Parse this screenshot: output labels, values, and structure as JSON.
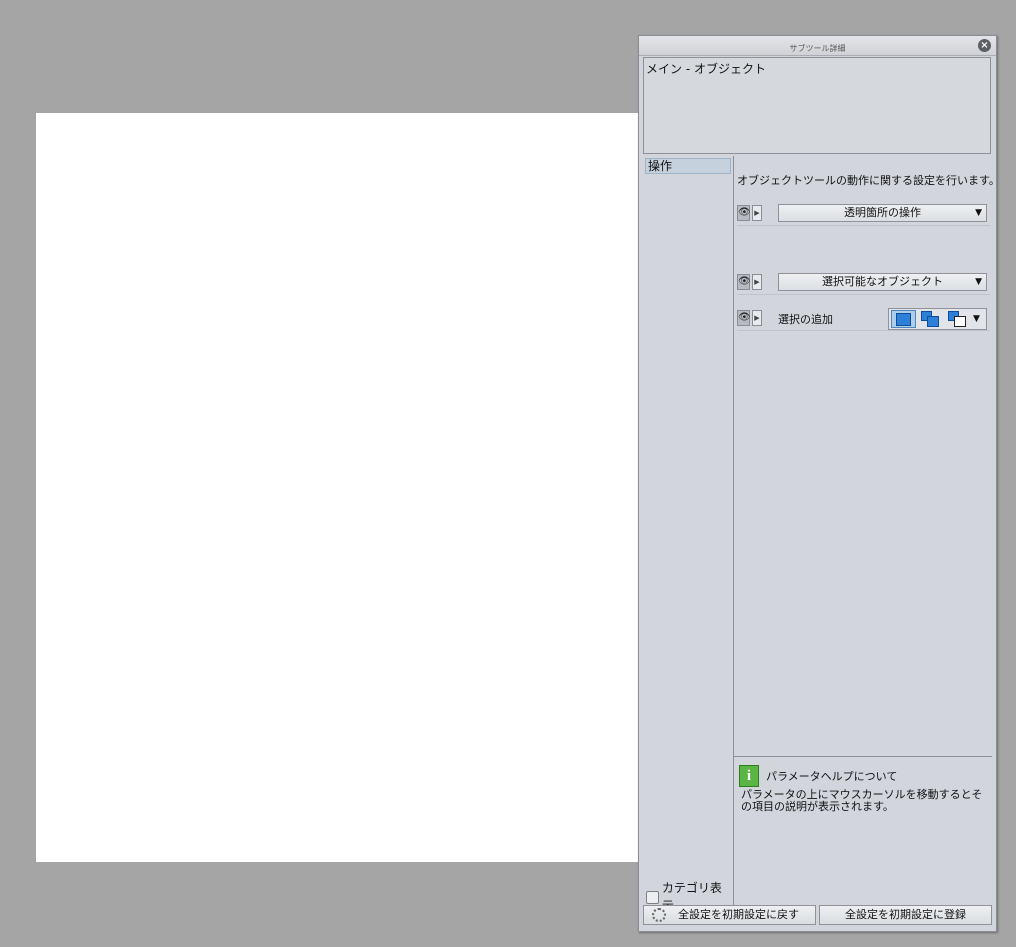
{
  "panel": {
    "title": "サブツール詳細",
    "close_icon": "×",
    "subtool_name": "メイン - オブジェクト"
  },
  "categories": {
    "items": [
      {
        "label": "操作"
      }
    ],
    "show_category_label": "カテゴリ表示"
  },
  "settings": {
    "description": "オブジェクトツールの動作に関する設定を行います。",
    "rows": [
      {
        "type": "dropdown",
        "label": "透明箇所の操作"
      },
      {
        "type": "dropdown",
        "label": "選択可能なオブジェクト"
      },
      {
        "type": "mode_select",
        "label": "選択の追加",
        "modes": [
          "new-selection",
          "add-to-selection",
          "toggle-selection"
        ],
        "active": "new-selection"
      }
    ]
  },
  "help": {
    "title": "パラメータヘルプについて",
    "body": "パラメータの上にマウスカーソルを移動するとその項目の説明が表示されます。"
  },
  "footer": {
    "reset_label": "全設定を初期設定に戻す",
    "register_label": "全設定を初期設定に登録"
  },
  "colors": {
    "workspace": "#a5a5a5",
    "panel": "#d2d6dc",
    "accent": "#2d7fd8",
    "help_icon": "#5bb544"
  }
}
